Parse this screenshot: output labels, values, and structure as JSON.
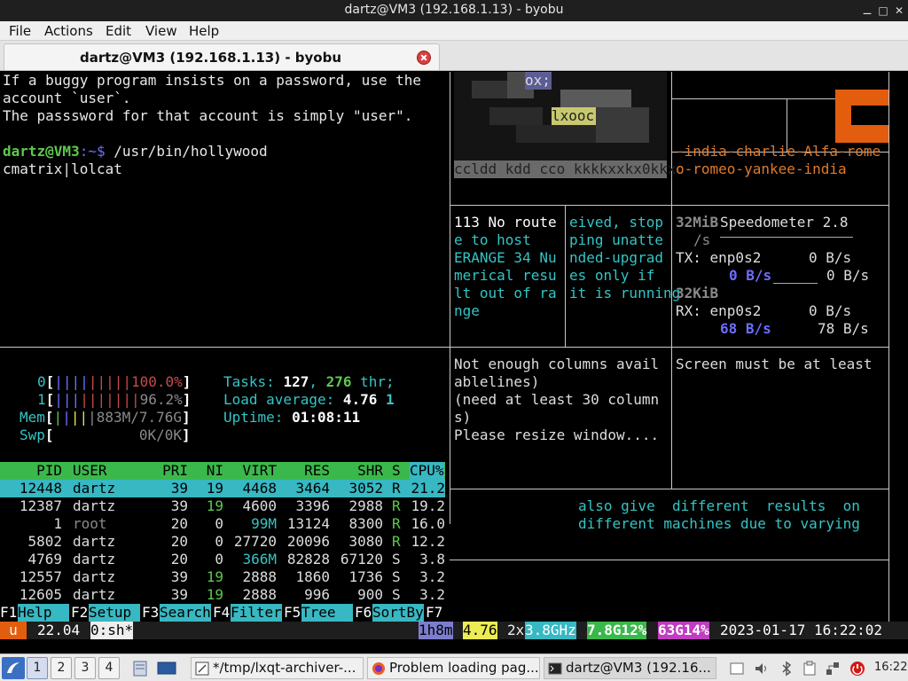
{
  "window": {
    "title": "dartz@VM3 (192.168.1.13) - byobu",
    "controls": [
      "minimize",
      "maximize",
      "close"
    ]
  },
  "menu": [
    "File",
    "Actions",
    "Edit",
    "View",
    "Help"
  ],
  "tab": {
    "label": "dartz@VM3 (192.168.1.13) - byobu"
  },
  "terminal": {
    "pane_main": {
      "line1": "If a buggy program insists on a password, use the",
      "line2": "account `user`.",
      "line3": "The passsword for that account is simply \"user\".",
      "prompt_user": "dartz@VM3",
      "prompt_sep": ":~$",
      "prompt_cmd": " /usr/bin/hollywood",
      "line_cmatrix": "cmatrix|lolcat"
    },
    "art_text": {
      "row1": "ox;",
      "row2": "lxooc",
      "row3": "ccldd kdd cco kkkkxxkx0kkxc"
    },
    "nato": {
      "line1": "-india-charlie-Alfa-rome",
      "line2": "o-romeo-yankee-india"
    },
    "mtr": {
      "col1": [
        "113 No route",
        "e to host",
        "ERANGE 34 Nu",
        "merical resu",
        "lt out of ra",
        "nge"
      ],
      "col2": [
        "eived, stop",
        "ping unatte",
        "nded-upgrad",
        "es only if",
        "it is running"
      ]
    },
    "speedometer": {
      "top_unit": "32MiB",
      "title": "Speedometer 2.8",
      "unit_rate": "/s",
      "tx_label": "TX: enp0s2",
      "tx_val1": "0 B/s",
      "tx_rate": "0 B/s",
      "tx_val2": "0 B/s",
      "mid_unit": "32KiB",
      "rx_label": "RX: enp0s2",
      "rx_val1": "0 B/s",
      "rx_rate": "68 B/s",
      "rx_val2": "78 B/s"
    },
    "notice": {
      "lines": [
        "Not enough columns avail",
        "ablelines)",
        "(need at least 30 column",
        "s)",
        "Please resize window...."
      ],
      "screen_msg": "Screen must be at least"
    },
    "fortune": {
      "line1": "also give  different  results  on",
      "line2": "different machines due to varying"
    },
    "htop": {
      "cpu0_label": "0",
      "cpu0_pct": "100.0%",
      "cpu1_label": "1",
      "cpu1_pct": "96.2%",
      "mem_label": "Mem",
      "mem_val": "883M/7.76G",
      "swp_label": "Swp",
      "swp_val": "0K/0K",
      "tasks_label": "Tasks: ",
      "tasks_count": "127",
      "tasks_thr": "276",
      "tasks_thr_label": " thr;",
      "load_label": "Load average: ",
      "load1": "4.76",
      "load2": "1",
      "uptime_label": "Uptime: ",
      "uptime": "01:08:11",
      "columns": [
        "PID",
        "USER",
        "PRI",
        "NI",
        "VIRT",
        "RES",
        "SHR",
        "S",
        "CPU%"
      ],
      "rows": [
        {
          "pid": "12448",
          "user": "dartz",
          "pri": "39",
          "ni": "19",
          "virt": "4468",
          "res": "3464",
          "shr": "3052",
          "s": "R",
          "cpu": "21.2"
        },
        {
          "pid": "12387",
          "user": "dartz",
          "pri": "39",
          "ni": "19",
          "virt": "4600",
          "res": "3396",
          "shr": "2988",
          "s": "R",
          "cpu": "19.2"
        },
        {
          "pid": "1",
          "user": "root",
          "pri": "20",
          "ni": "0",
          "virt": "99M",
          "res": "13124",
          "shr": "8300",
          "s": "R",
          "cpu": "16.0"
        },
        {
          "pid": "5802",
          "user": "dartz",
          "pri": "20",
          "ni": "0",
          "virt": "27720",
          "res": "20096",
          "shr": "3080",
          "s": "R",
          "cpu": "12.2"
        },
        {
          "pid": "4769",
          "user": "dartz",
          "pri": "20",
          "ni": "0",
          "virt": "366M",
          "res": "82828",
          "shr": "67120",
          "s": "S",
          "cpu": "3.8"
        },
        {
          "pid": "12557",
          "user": "dartz",
          "pri": "39",
          "ni": "19",
          "virt": "2888",
          "res": "1860",
          "shr": "1736",
          "s": "S",
          "cpu": "3.2"
        },
        {
          "pid": "12605",
          "user": "dartz",
          "pri": "39",
          "ni": "19",
          "virt": "2888",
          "res": "996",
          "shr": "900",
          "s": "S",
          "cpu": "3.2"
        }
      ],
      "fkeys": [
        {
          "key": "F1",
          "label": "Help  "
        },
        {
          "key": "F2",
          "label": "Setup "
        },
        {
          "key": "F3",
          "label": "Search"
        },
        {
          "key": "F4",
          "label": "Filter"
        },
        {
          "key": "F5",
          "label": "Tree  "
        },
        {
          "key": "F6",
          "label": "SortBy"
        },
        {
          "key": "F7",
          "label": ""
        }
      ]
    },
    "byobu": {
      "u": "u",
      "load": "22.04",
      "window": "0:sh*",
      "uptime": "1h8m",
      "load_avg": "4.76",
      "cpu": "2x",
      "ghz": "3.8GHz",
      "mem_g": "7.8G",
      "mem_pct": "12%",
      "disk_g": "63G",
      "disk_pct": "14%",
      "datetime": "2023-01-17 16:22:02"
    }
  },
  "taskbar": {
    "workspaces": [
      "1",
      "2",
      "3",
      "4"
    ],
    "tasks": [
      {
        "label": "*/tmp/lxqt-archiver-..."
      },
      {
        "label": "Problem loading pag..."
      },
      {
        "label": "dartz@VM3 (192.16..."
      }
    ],
    "clock": "16:22"
  },
  "colors": {
    "htop_green": "#3bb84b",
    "htop_cyan": "#37b8c2",
    "logo_orange": "#e35d0f"
  }
}
